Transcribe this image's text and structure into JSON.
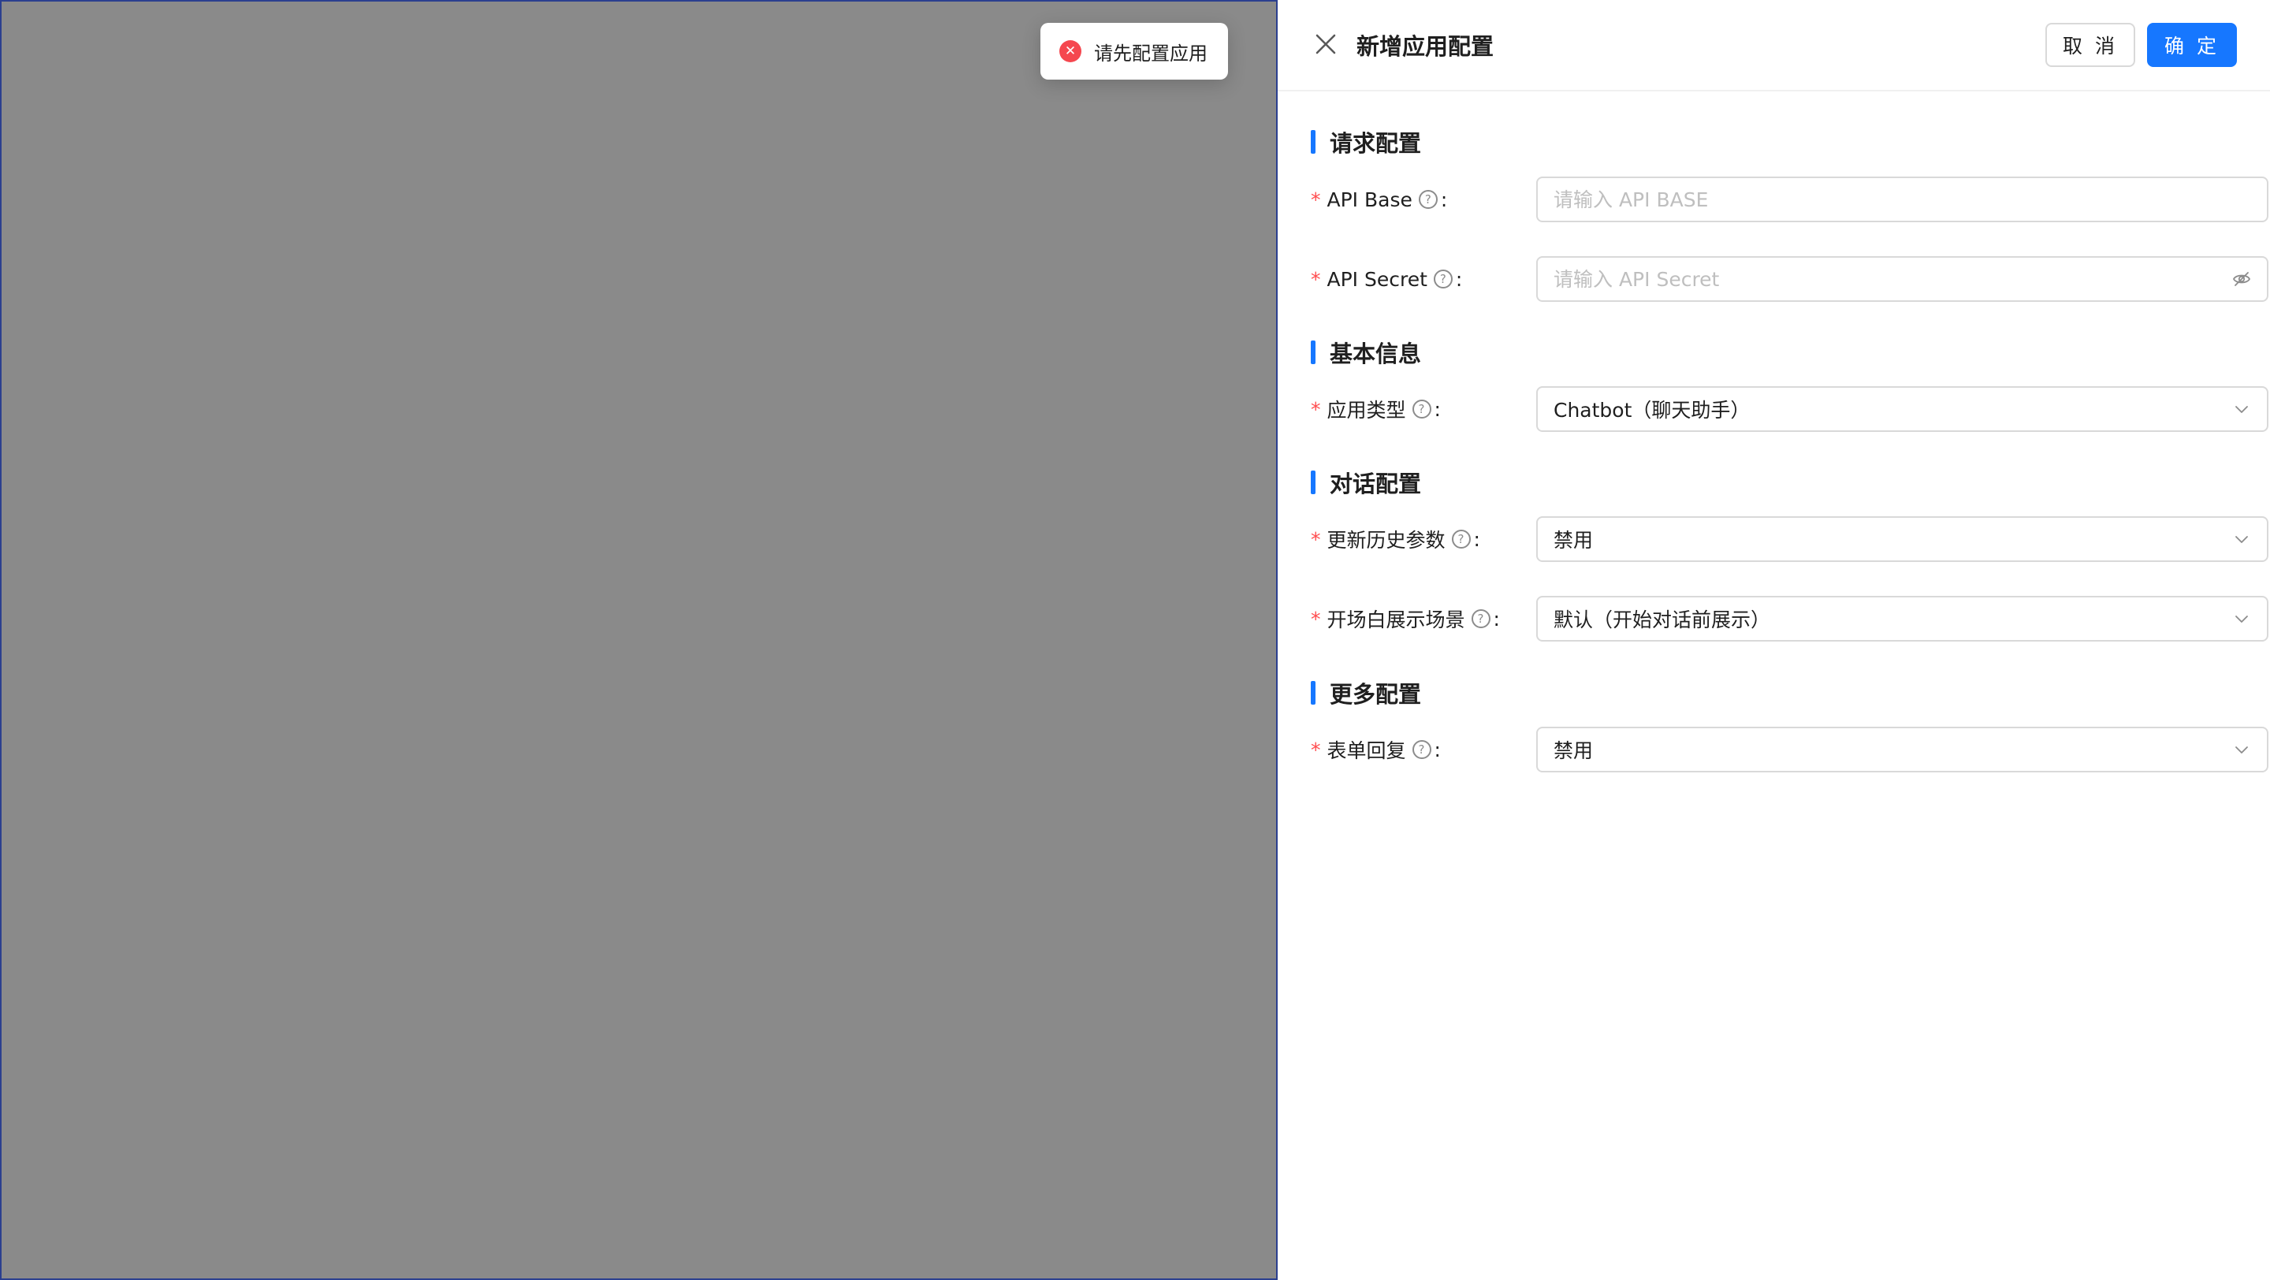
{
  "toast": {
    "text": "请先配置应用",
    "icon": "error-circle-icon",
    "icon_glyph": "✕"
  },
  "drawer": {
    "title": "新增应用配置",
    "cancel_label": "取 消",
    "ok_label": "确 定",
    "sections": {
      "request": {
        "title": "请求配置",
        "api_base": {
          "label": "API Base",
          "placeholder": "请输入 API BASE",
          "value": ""
        },
        "api_secret": {
          "label": "API Secret",
          "placeholder": "请输入 API Secret",
          "value": ""
        }
      },
      "basic": {
        "title": "基本信息",
        "app_type": {
          "label": "应用类型",
          "value": "Chatbot（聊天助手）"
        }
      },
      "conversation": {
        "title": "对话配置",
        "update_history": {
          "label": "更新历史参数",
          "value": "禁用"
        },
        "opening_scene": {
          "label": "开场白展示场景",
          "value": "默认（开始对话前展示）"
        }
      },
      "more": {
        "title": "更多配置",
        "form_reply": {
          "label": "表单回复",
          "value": "禁用"
        }
      }
    },
    "required_mark": "*",
    "help_glyph": "?",
    "colon": ":"
  },
  "colors": {
    "primary": "#1677ff",
    "error": "#ff4d4f",
    "mask": "#8a8a8a"
  }
}
